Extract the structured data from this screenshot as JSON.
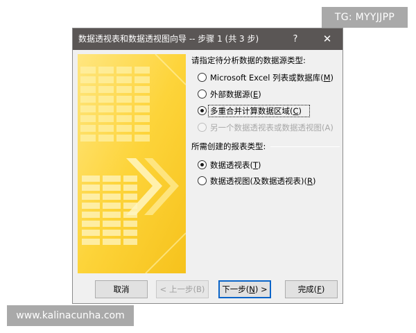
{
  "watermarks": {
    "tg": "TG: MYYJJPP",
    "site": "www.kalinacunha.com"
  },
  "dialog": {
    "title": "数据透视表和数据透视图向导 -- 步骤 1 (共 3 步)",
    "help_glyph": "?",
    "close_glyph": "✕"
  },
  "source_section": {
    "label": "请指定待分析数据的数据源类型:",
    "options": [
      {
        "text": "Microsoft Excel 列表或数据库(",
        "key": "M",
        "suffix": ")",
        "checked": false,
        "disabled": false
      },
      {
        "text": "外部数据源(",
        "key": "E",
        "suffix": ")",
        "checked": false,
        "disabled": false
      },
      {
        "text": "多重合并计算数据区域(",
        "key": "C",
        "suffix": ")",
        "checked": true,
        "disabled": false
      },
      {
        "text": "另一个数据透视表或数据透视图(A)",
        "key": "",
        "suffix": "",
        "checked": false,
        "disabled": true
      }
    ]
  },
  "report_section": {
    "label": "所需创建的报表类型:",
    "options": [
      {
        "text": "数据透视表(",
        "key": "T",
        "suffix": ")",
        "checked": true,
        "disabled": false
      },
      {
        "text": "数据透视图(及数据透视表)(",
        "key": "R",
        "suffix": ")",
        "checked": false,
        "disabled": false
      }
    ]
  },
  "buttons": {
    "cancel": "取消",
    "back": "< 上一步(B)",
    "next_prefix": "下一步(",
    "next_key": "N",
    "next_suffix": ") >",
    "finish_prefix": "完成(",
    "finish_key": "F",
    "finish_suffix": ")"
  },
  "colors": {
    "titlebar": "#5a5655",
    "illustration_yellow": "#fcd63a",
    "illustration_light": "#fff3b0",
    "default_button_border": "#0a64c8"
  }
}
